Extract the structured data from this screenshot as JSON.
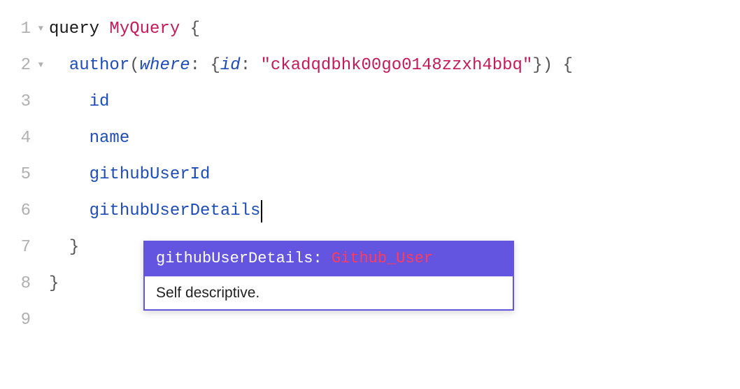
{
  "gutter": {
    "lines": [
      "1",
      "2",
      "3",
      "4",
      "5",
      "6",
      "7",
      "8",
      "9"
    ],
    "foldable": [
      true,
      true,
      false,
      false,
      false,
      false,
      false,
      false,
      false
    ]
  },
  "code": {
    "keyword_query": "query",
    "operation_name": "MyQuery",
    "open_brace": " {",
    "field_author": "author",
    "paren_open": "(",
    "arg_where": "where",
    "colon": ":",
    "inner_open": " {",
    "arg_id": "id",
    "string_value": "\"ckadqdbhk00go0148zzxh4bbq\"",
    "inner_close": "}",
    "paren_close": ")",
    "block_open": " {",
    "field_id": "id",
    "field_name": "name",
    "field_githubUserId": "githubUserId",
    "field_githubUserDetails": "githubUserDetails",
    "close_brace1": "}",
    "close_brace2": "}"
  },
  "tooltip": {
    "field": "githubUserDetails",
    "sep": ": ",
    "type": "Github_User",
    "description": "Self descriptive."
  }
}
